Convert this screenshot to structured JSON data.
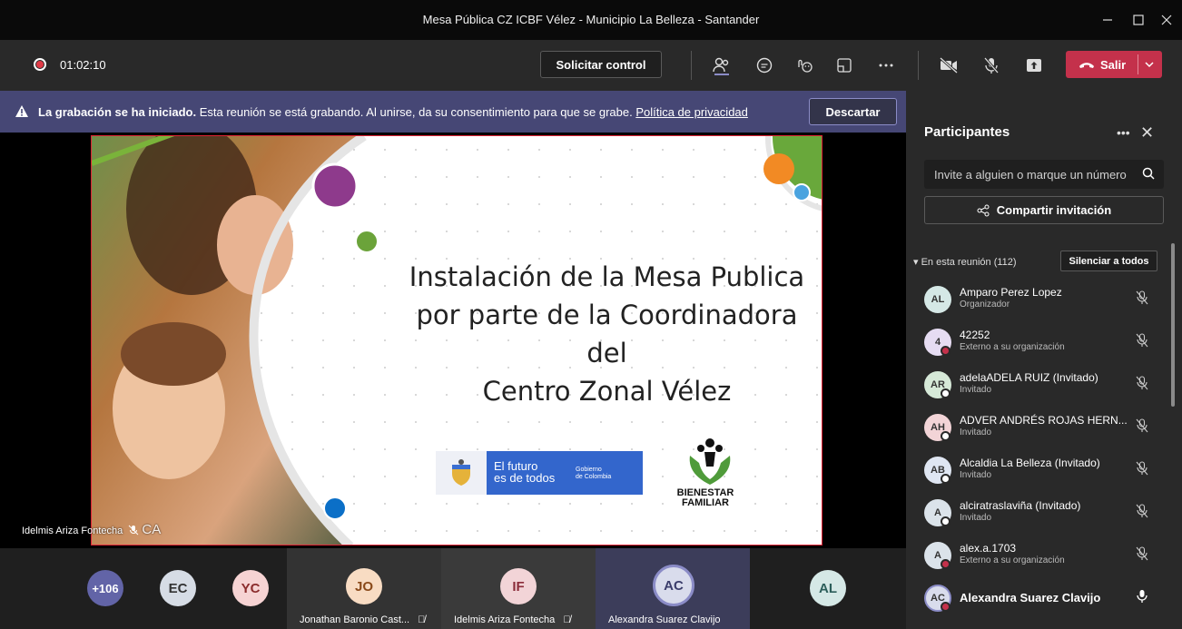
{
  "window": {
    "title": "Mesa Pública CZ ICBF Vélez - Municipio La Belleza - Santander"
  },
  "toolbar": {
    "timer": "01:02:10",
    "request_control": "Solicitar control",
    "leave_label": "Salir",
    "leave_color": "#c4314b"
  },
  "banner": {
    "bold": "La grabación se ha iniciado.",
    "text": " Esta reunión se está grabando. Al unirse, da su consentimiento para que se grabe. ",
    "link": "Política de privacidad",
    "dismiss": "Descartar",
    "color": "#464775"
  },
  "slide": {
    "title_lines": [
      "Instalación de la Mesa Publica",
      "por parte de la Coordinadora del",
      "Centro Zonal Vélez"
    ],
    "gov_logo_line1": "El futuro",
    "gov_logo_line2": "es de todos",
    "gov_logo_small1": "Gobierno",
    "gov_logo_small2": "de Colombia",
    "bf_logo_line1": "BIENESTAR",
    "bf_logo_line2": "FAMILIAR"
  },
  "stage": {
    "presenter_name": "Idelmis Ariza Fontecha",
    "presenter_extra": "CA"
  },
  "strip": {
    "overflow": "+106",
    "tiles": [
      {
        "initials": "EC",
        "name": ""
      },
      {
        "initials": "YC",
        "name": ""
      },
      {
        "initials": "JO",
        "name": "Jonathan Baronio Cast..."
      },
      {
        "initials": "IF",
        "name": "Idelmis Ariza Fontecha"
      },
      {
        "initials": "AC",
        "name": "Alexandra Suarez Clavijo"
      },
      {
        "initials": "AL",
        "name": ""
      }
    ]
  },
  "panel": {
    "title": "Participantes",
    "search_placeholder": "Invite a alguien o marque un número",
    "share_label": "Compartir invitación",
    "section_label": "En esta reunión (112)",
    "mute_all": "Silenciar a todos",
    "participants": [
      {
        "initials": "AL",
        "name": "Amparo Perez Lopez",
        "sub": "Organizador",
        "status": "none",
        "bold": false
      },
      {
        "initials": "4",
        "name": "42252",
        "sub": "Externo a su organización",
        "status": "red",
        "bold": false
      },
      {
        "initials": "AR",
        "name": "adelaADELA RUIZ (Invitado)",
        "sub": "Invitado",
        "status": "white",
        "bold": false
      },
      {
        "initials": "AH",
        "name": "ADVER ANDRÉS ROJAS HERN...",
        "sub": "Invitado",
        "status": "white",
        "bold": false
      },
      {
        "initials": "AB",
        "name": "Alcaldia La Belleza (Invitado)",
        "sub": "Invitado",
        "status": "white",
        "bold": false
      },
      {
        "initials": "A",
        "name": "alciratraslaviña (Invitado)",
        "sub": "Invitado",
        "status": "white",
        "bold": false
      },
      {
        "initials": "A",
        "name": "alex.a.1703",
        "sub": "Externo a su organización",
        "status": "red",
        "bold": false
      },
      {
        "initials": "AC",
        "name": "Alexandra Suarez Clavijo",
        "sub": "",
        "status": "red",
        "bold": true
      }
    ]
  }
}
